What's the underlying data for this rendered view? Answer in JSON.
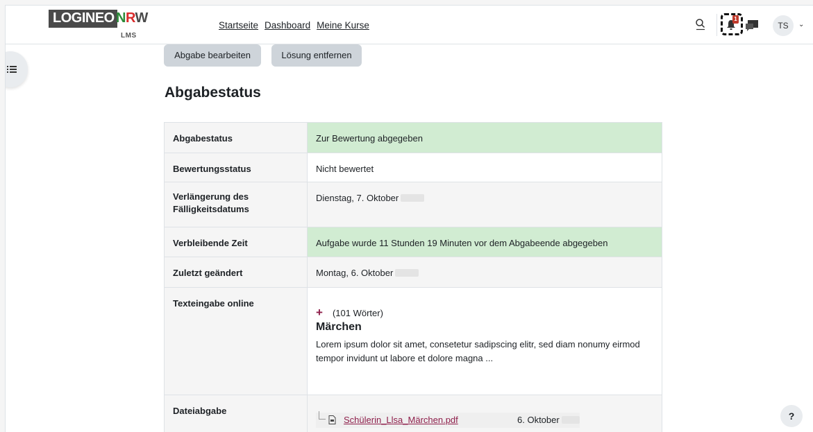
{
  "header": {
    "logo_text": "LOGINEO",
    "logo_nrw_n": "N",
    "logo_nrw_r": "R",
    "logo_nrw_w": "W",
    "logo_sub": "LMS",
    "nav": [
      "Startseite",
      "Dashboard",
      "Meine Kurse"
    ],
    "notification_count": "1",
    "user_initials": "TS",
    "icons": [
      "search-icon",
      "bell-icon",
      "message-icon",
      "chevron-down-icon",
      "list-icon"
    ]
  },
  "actions": {
    "edit_label": "Abgabe bearbeiten",
    "remove_label": "Lösung entfernen"
  },
  "page_title": "Abgabestatus",
  "status_table": {
    "rows": [
      {
        "label": "Abgabestatus",
        "value": "Zur Bewertung abgegeben"
      },
      {
        "label": "Bewertungsstatus",
        "value": "Nicht bewertet"
      },
      {
        "label": "Verlängerung des Fälligkeitsdatums",
        "value": "Dienstag, 7. Oktober"
      },
      {
        "label": "Verbleibende Zeit",
        "value": "Aufgabe wurde 11 Stunden 19 Minuten vor dem Abgabeende abgegeben"
      },
      {
        "label": "Zuletzt geändert",
        "value": "Montag, 6. Oktober"
      },
      {
        "label": "Texteingabe online",
        "word_count": "(101 Wörter)",
        "title": "Märchen",
        "text": "Lorem ipsum dolor sit amet, consetetur sadipscing elitr, sed diam nonumy eirmod tempor invidunt ut labore et dolore magna ..."
      },
      {
        "label": "Dateiabgabe",
        "file_name": "Schülerin_Llsa_Märchen.pdf",
        "file_date": "6. Oktober"
      }
    ]
  },
  "help_label": "?",
  "colors": {
    "success_bg": "#d1ecd2",
    "link": "#8e1e4a",
    "button_bg": "#ced4da"
  }
}
